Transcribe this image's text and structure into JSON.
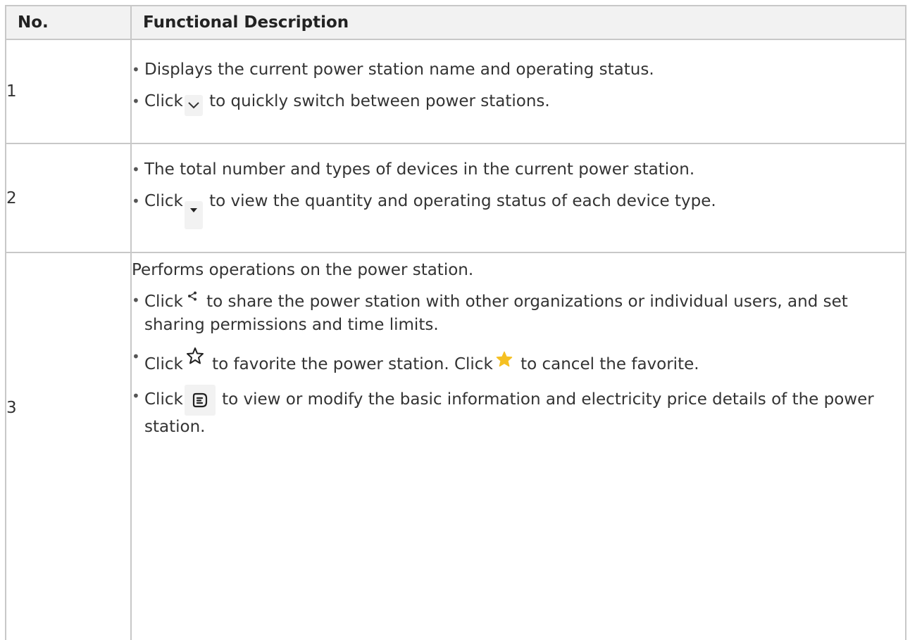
{
  "table": {
    "headers": {
      "no": "No.",
      "description": "Functional Description"
    },
    "rows": [
      {
        "no": "1",
        "bullets": [
          {
            "text": "Displays the current power station name and operating status."
          },
          {
            "before": "Click",
            "icon": "chevron-down-icon",
            "after": " to quickly switch between power stations."
          }
        ]
      },
      {
        "no": "2",
        "bullets": [
          {
            "text": "The total number and types of devices in the current power station."
          },
          {
            "before": "Click",
            "icon": "caret-down-icon",
            "after": " to view the quantity and operating status of each device type."
          }
        ]
      },
      {
        "no": "3",
        "intro": "Performs operations on the power station.",
        "bullets": [
          {
            "before": "Click",
            "icon": "share-icon",
            "after": "  to share the power station with other organizations or individual users, and set sharing permissions and time limits."
          },
          {
            "before": "Click",
            "icon": "star-outline-icon",
            "middle": " to favorite the power station. Click",
            "icon2": "star-filled-icon",
            "after": "  to cancel the favorite."
          },
          {
            "before": "Click",
            "icon": "info-card-icon",
            "after": "  to view or modify the basic information and electricity price details of the power station."
          }
        ]
      }
    ]
  },
  "colors": {
    "border": "#c8c8c8",
    "header_bg": "#f2f2f2",
    "text": "#333333",
    "star_filled": "#f5c022",
    "icon_box_bg": "#f2f2f2"
  }
}
